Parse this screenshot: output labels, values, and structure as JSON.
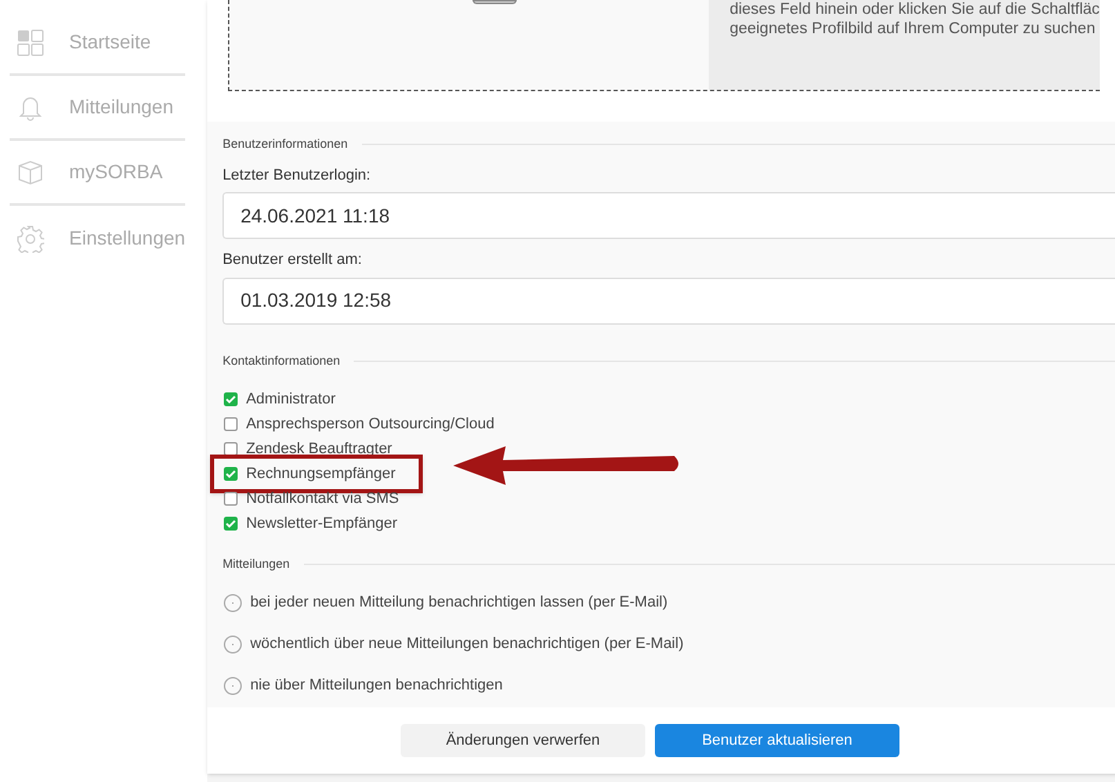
{
  "sidebar": {
    "items": [
      {
        "label": "Startseite"
      },
      {
        "label": "Mitteilungen"
      },
      {
        "label": "mySORBA"
      },
      {
        "label": "Einstellungen"
      }
    ]
  },
  "profile_upload": {
    "hint_lines": [
      "dieses Feld hinein oder klicken Sie auf die Schaltfläc",
      "geeignetes Profilbild auf Ihrem Computer zu suchen"
    ]
  },
  "user_info": {
    "heading": "Benutzerinformationen",
    "fields": [
      {
        "label": "Letzter Benutzerlogin:",
        "value": "24.06.2021 11:18"
      },
      {
        "label": "Benutzer erstellt am:",
        "value": "01.03.2019 12:58"
      }
    ]
  },
  "contact_info": {
    "heading": "Kontaktinformationen",
    "options": [
      {
        "label": "Administrator",
        "checked": true,
        "highlighted": false
      },
      {
        "label": "Ansprechsperson Outsourcing/Cloud",
        "checked": false,
        "highlighted": false
      },
      {
        "label": "Zendesk Beauftragter",
        "checked": false,
        "highlighted": false
      },
      {
        "label": "Rechnungsempfänger",
        "checked": true,
        "highlighted": true
      },
      {
        "label": "Notfallkontakt via SMS",
        "checked": false,
        "highlighted": false
      },
      {
        "label": "Newsletter-Empfänger",
        "checked": true,
        "highlighted": false
      }
    ]
  },
  "notifications": {
    "heading": "Mitteilungen",
    "options": [
      {
        "label": "bei jeder neuen Mitteilung benachrichtigen lassen (per E-Mail)",
        "selected": false
      },
      {
        "label": "wöchentlich über neue Mitteilungen benachrichtigen (per E-Mail)",
        "selected": false
      },
      {
        "label": "nie über Mitteilungen benachrichtigen",
        "selected": false
      }
    ]
  },
  "buttons": [
    {
      "label": "Änderungen verwerfen",
      "kind": "secondary"
    },
    {
      "label": "Benutzer aktualisieren",
      "kind": "primary"
    }
  ]
}
